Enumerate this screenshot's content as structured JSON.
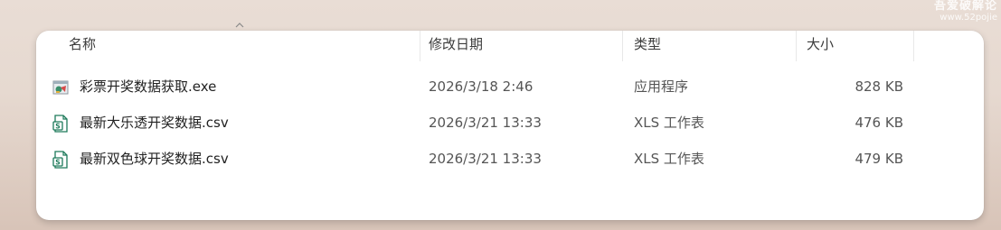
{
  "watermark": {
    "line1": "吾爱破解论",
    "line2": "www.52pojie"
  },
  "columns": {
    "name": "名称",
    "modified": "修改日期",
    "type": "类型",
    "size": "大小"
  },
  "files": [
    {
      "name": "彩票开奖数据获取.exe",
      "modified": "2026/3/18 2:46",
      "type": "应用程序",
      "size": "828 KB",
      "icon": "exe-app-icon"
    },
    {
      "name": "最新大乐透开奖数据.csv",
      "modified": "2026/3/21 13:33",
      "type": "XLS 工作表",
      "size": "476 KB",
      "icon": "spreadsheet-file-icon"
    },
    {
      "name": "最新双色球开奖数据.csv",
      "modified": "2026/3/21 13:33",
      "type": "XLS 工作表",
      "size": "479 KB",
      "icon": "spreadsheet-file-icon"
    }
  ],
  "colors": {
    "spreadsheet_icon": "#1d7a5a",
    "header_text": "#3b3b3b",
    "row_text": "#222222"
  }
}
